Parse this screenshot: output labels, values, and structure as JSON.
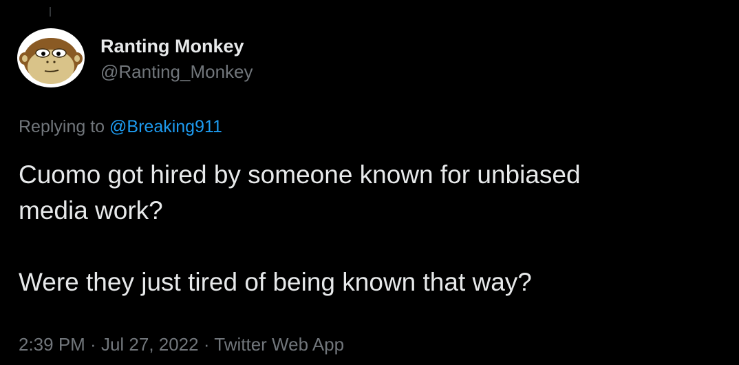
{
  "user": {
    "display_name": "Ranting Monkey",
    "handle": "@Ranting_Monkey",
    "avatar_icon": "monkey-face-icon"
  },
  "reply": {
    "prefix": "Replying to ",
    "mention": "@Breaking911"
  },
  "tweet": {
    "line1": "Cuomo got hired by someone known for unbiased",
    "line2": "media work?",
    "line3": "Were they just tired of being known that way?"
  },
  "meta": {
    "time": "2:39 PM",
    "sep1": " · ",
    "date": "Jul 27, 2022",
    "sep2": " · ",
    "source": "Twitter Web App"
  },
  "colors": {
    "background": "#000000",
    "text_primary": "#e7e9ea",
    "text_secondary": "#71767b",
    "link": "#1d9bf0"
  }
}
